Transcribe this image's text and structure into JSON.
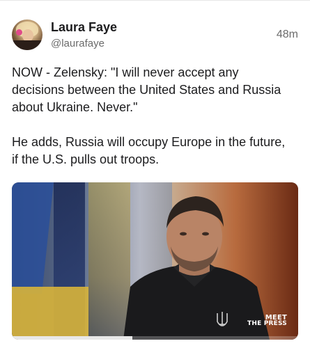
{
  "post": {
    "author_name": "Laura Faye",
    "author_handle": "@laurafaye",
    "timestamp": "48m",
    "paragraphs": [
      "NOW - Zelensky: \"I will never accept any decisions between the United States and Russia about Ukraine. Never.\"",
      "He adds, Russia will occupy Europe in the future, if the U.S. pulls out troops."
    ]
  },
  "media": {
    "logo_line1": "MEET",
    "logo_line2": "THE PRESS",
    "video_progress": 0.42
  },
  "colors": {
    "text": "#1c1c1e",
    "secondary_text": "#6b6b6b"
  }
}
